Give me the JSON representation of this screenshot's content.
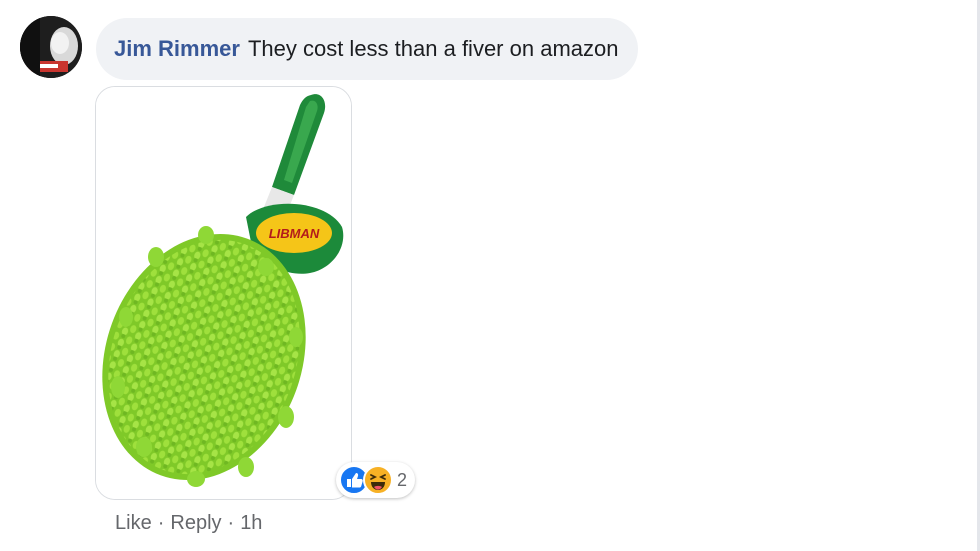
{
  "comment": {
    "author": "Jim Rimmer",
    "text": "They cost less than a fiver on amazon",
    "avatar_icon": "user-avatar",
    "photo": {
      "subject": "green microfiber duster",
      "brand_label": "LIBMAN"
    },
    "reactions": {
      "types": [
        "like-icon",
        "haha-icon"
      ],
      "count": "2"
    },
    "actions": {
      "like": "Like",
      "reply": "Reply",
      "time": "1h",
      "separator": "·"
    }
  },
  "colors": {
    "author": "#385898",
    "bubble_bg": "#f0f2f5",
    "text": "#1c1e21",
    "muted": "#65676b",
    "like_blue": "#1877f2",
    "haha_yellow": "#f7b125",
    "duster_green": "#8ed62f",
    "handle_green": "#1f8a3a"
  }
}
